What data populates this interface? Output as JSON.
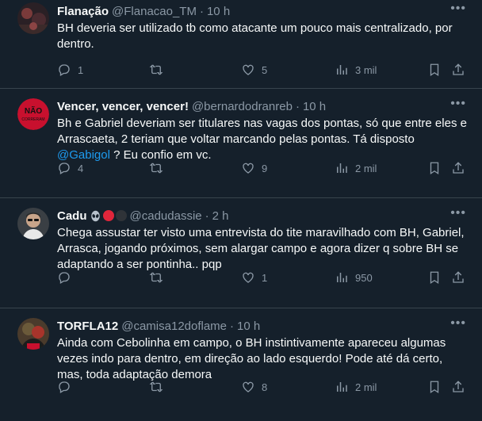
{
  "tweets": [
    {
      "name": "Flanação",
      "handle": "@Flanacao_TM",
      "time": "10 h",
      "text": "BH deveria ser utilizado tb como atacante um pouco mais centralizado, por dentro.",
      "replies": "1",
      "retweets": "",
      "likes": "5",
      "views": "3 mil"
    },
    {
      "name": "Vencer, vencer, vencer!",
      "handle": "@bernardodranreb",
      "time": "10 h",
      "text_before": "Bh e Gabriel deveriam ser titulares nas vagas dos pontas, só que entre eles e Arrascaeta, 2 teriam que voltar marcando pelas pontas. Tá disposto ",
      "mention": "@Gabigol",
      "text_after": " ? Eu confio em vc.",
      "replies": "4",
      "retweets": "",
      "likes": "9",
      "views": "2 mil",
      "avatar_text": "NÃO CORRERAM"
    },
    {
      "name": "Cadu",
      "handle": "@cadudassie",
      "time": "2 h",
      "text": "Chega assustar ter visto uma entrevista do tite maravilhado com BH, Gabriel, Arrasca, jogando próximos, sem alargar campo e agora dizer q sobre BH se adaptando a ser pontinha.. pqp",
      "replies": "",
      "retweets": "",
      "likes": "1",
      "views": "950"
    },
    {
      "name": "TORFLA12",
      "handle": "@camisa12doflame",
      "time": "10 h",
      "text": "Ainda com Cebolinha em campo, o BH instintivamente apareceu algumas vezes indo para dentro, em direção ao lado esquerdo! Pode até dá certo, mas, toda adaptação demora",
      "replies": "",
      "retweets": "",
      "likes": "8",
      "views": "2 mil"
    }
  ],
  "colors": {
    "background": "#15202b",
    "border": "#38444d",
    "secondary_text": "#8b98a5",
    "link": "#1d9bf0"
  },
  "icons": [
    "more-icon",
    "reply-icon",
    "retweet-icon",
    "like-icon",
    "views-icon",
    "bookmark-icon",
    "share-icon",
    "alien-emoji-icon"
  ]
}
